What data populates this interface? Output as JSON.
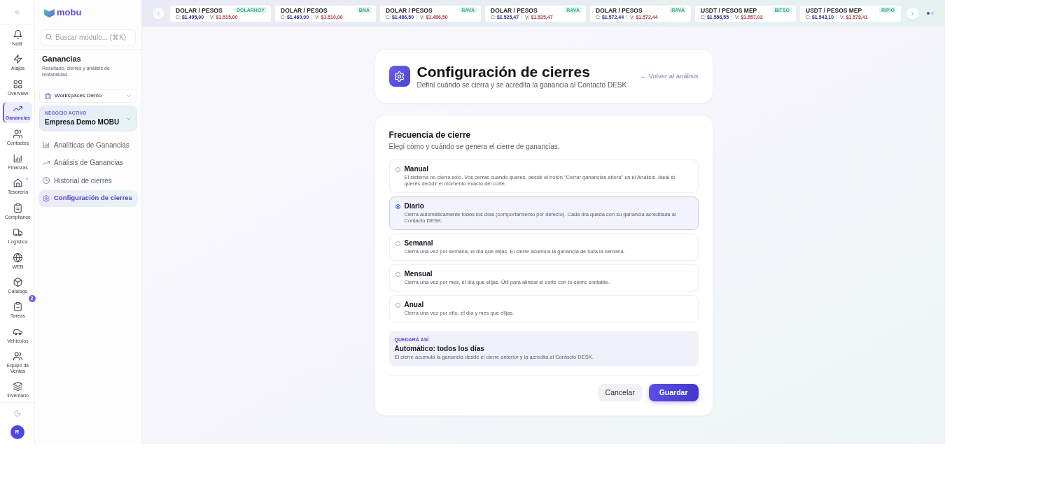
{
  "rail": {
    "items": [
      {
        "label": "Notif.",
        "selected": false,
        "dot": false
      },
      {
        "label": "Atajos",
        "selected": false,
        "dot": false
      },
      {
        "label": "Overview",
        "selected": false,
        "dot": false
      },
      {
        "label": "Ganancias",
        "selected": true,
        "dot": false
      },
      {
        "label": "Contactos",
        "selected": false,
        "dot": false
      },
      {
        "label": "Finanzas",
        "selected": false,
        "dot": false
      },
      {
        "label": "Tesorería",
        "selected": false,
        "dot": true
      },
      {
        "label": "Compliance",
        "selected": false,
        "dot": false
      },
      {
        "label": "Logística",
        "selected": false,
        "dot": false
      },
      {
        "label": "WEB",
        "selected": false,
        "dot": false
      },
      {
        "label": "Catálogo",
        "selected": false,
        "dot": false
      },
      {
        "label": "Tareas",
        "selected": false,
        "dot": false,
        "badge": "2"
      },
      {
        "label": "Vehículos",
        "selected": false,
        "dot": false
      },
      {
        "label": "Equipo de Ventas",
        "selected": false,
        "dot": false
      },
      {
        "label": "Inventario",
        "selected": false,
        "dot": false
      }
    ],
    "avatar": "R"
  },
  "sidebar": {
    "logo": "mobu",
    "search": {
      "placeholder": "Buscar módulo... (⌘K)"
    },
    "section": {
      "title": "Ganancias",
      "subtitle": "Resultado, cierres y análisis de rentabilidad."
    },
    "workspace": "Workspaces Demo",
    "business": {
      "label": "NEGOCIO ACTIVO",
      "name": "Empresa Demo MOBU"
    },
    "nav": [
      {
        "label": "Analíticas de Ganancias",
        "selected": false
      },
      {
        "label": "Análisis de Ganancias",
        "selected": false
      },
      {
        "label": "Historial de cierres",
        "selected": false
      },
      {
        "label": "Configuración de cierres",
        "selected": true
      }
    ]
  },
  "ticker": {
    "quotes": [
      {
        "pair": "DOLAR / PESOS",
        "source": "DOLARHOY",
        "buy": "C: **$1.495,00**",
        "sell": "V: **$1.515,00**"
      },
      {
        "pair": "DOLAR / PESOS",
        "source": "BNA",
        "buy": "C: **$1.460,00**",
        "sell": "V: **$1.510,00**"
      },
      {
        "pair": "DOLAR / PESOS",
        "source": "RAVA",
        "buy": "C: **$1.486,50**",
        "sell": "V: **$1.486,50**"
      },
      {
        "pair": "DOLAR / PESOS",
        "source": "RAVA",
        "buy": "C: **$1.525,47**",
        "sell": "V: **$1.525,47**"
      },
      {
        "pair": "DOLAR / PESOS",
        "source": "RAVA",
        "buy": "C: **$1.572,44**",
        "sell": "V: **$1.572,44**"
      },
      {
        "pair": "USDT / PESOS MEP",
        "source": "BITSO",
        "buy": "C: **$1.556,55**",
        "sell": "V: **$1.557,03**"
      },
      {
        "pair": "USDT / PESOS MEP",
        "source": "RIPIO",
        "buy": "C: **$1.543,10**",
        "sell": "V: **$1.578,41**"
      }
    ],
    "pages": [
      {
        "selected": true
      },
      {
        "selected": false
      }
    ]
  },
  "header": {
    "title": "Configuración de cierres",
    "subtitle": "Definí cuándo se cierra y se acredita la ganancia al Contacto DESK",
    "back_link": "← Volver al análisis"
  },
  "frequency": {
    "title": "Frecuencia de cierre",
    "subtitle": "Elegí cómo y cuándo se genera el cierre de ganancias.",
    "options": [
      {
        "label": "Manual",
        "description": "El sistema no cierra solo. Vos cerrás cuando querés, desde el botón \"Cerrar ganancias ahora\" en el Análisis. Ideal si querés decidir el momento exacto del corte.",
        "selected": false
      },
      {
        "label": "Diario",
        "description": "Cierra automáticamente todos los días (comportamiento por defecto). Cada día queda con su ganancia acreditada al Contacto DESK.",
        "selected": true
      },
      {
        "label": "Semanal",
        "description": "Cierra una vez por semana, el día que elijas. El cierre acumula la ganancia de toda la semana.",
        "selected": false
      },
      {
        "label": "Mensual",
        "description": "Cierra una vez por mes, el día que elijas. Útil para alinear el corte con tu cierre contable.",
        "selected": false
      },
      {
        "label": "Anual",
        "description": "Cierra una vez por año, el día y mes que elijas.",
        "selected": false
      }
    ],
    "summary": {
      "label": "QUEDARÁ ASÍ",
      "title": "Automático: todos los días",
      "description": "El cierre acumula la ganancia desde el cierre anterior y la acredita al Contacto DESK."
    },
    "buttons": [
      {
        "label": "Cancelar",
        "kind": "secondary"
      },
      {
        "label": "Guardar",
        "kind": "primary"
      }
    ]
  }
}
